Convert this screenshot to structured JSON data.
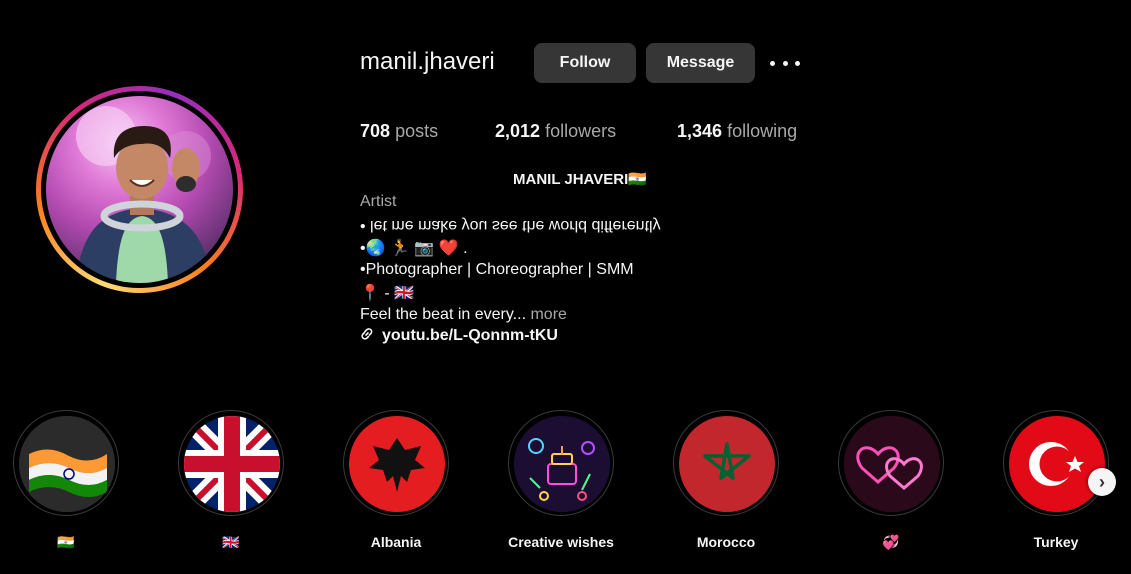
{
  "profile": {
    "username": "manil.jhaveri",
    "follow_label": "Follow",
    "message_label": "Message",
    "more_icon": "more-options-icon",
    "stats": {
      "posts_count": "708",
      "posts_label": "posts",
      "followers_count": "2,012",
      "followers_label": "followers",
      "following_count": "1,346",
      "following_label": "following"
    },
    "display_name": "MANIL JHAVERI🇮🇳",
    "category": "Artist",
    "bio": {
      "line1": "• let me make you see the world differently",
      "line2": "•🌏 🏃 📷 ❤️ .",
      "line3": "•Photographer | Choreographer | SMM",
      "line4": "📍 - 🇬🇧",
      "line5": "Feel the beat in every...",
      "more": "more"
    },
    "link": "youtu.be/L-Qonnm-tKU"
  },
  "highlights": [
    {
      "label": "🇮🇳"
    },
    {
      "label": "🇬🇧"
    },
    {
      "label": "Albania"
    },
    {
      "label": "Creative wishes"
    },
    {
      "label": "Morocco"
    },
    {
      "label": "💞"
    },
    {
      "label": "Turkey"
    }
  ],
  "colors": {
    "background": "#000000",
    "button": "#363636",
    "secondary_text": "#a8a8a8"
  }
}
